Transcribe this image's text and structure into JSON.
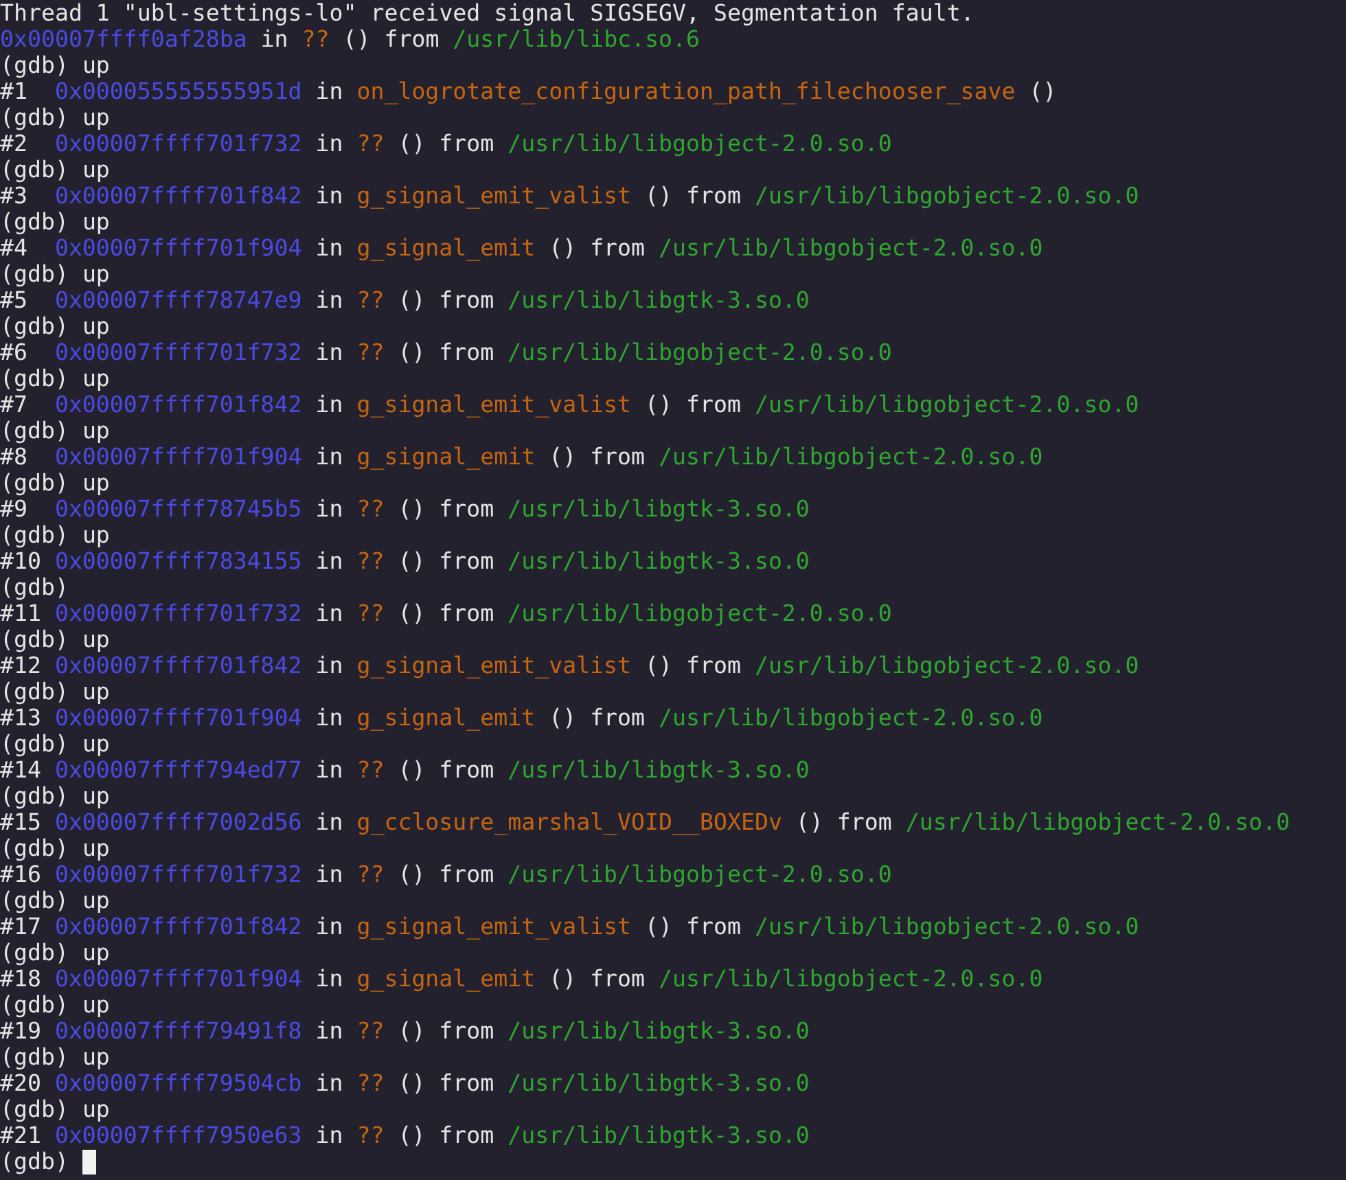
{
  "terminal": {
    "lines": [
      {
        "parts": [
          {
            "kind": "plain",
            "text": "Thread 1 \"ubl-settings-lo\" received signal SIGSEGV, Segmentation fault."
          }
        ]
      },
      {
        "parts": [
          {
            "kind": "address",
            "text": "0x00007ffff0af28ba"
          },
          {
            "kind": "plain",
            "text": "in"
          },
          {
            "kind": "function",
            "text": "??"
          },
          {
            "kind": "plain",
            "text": "() from"
          },
          {
            "kind": "path",
            "text": "/usr/lib/libc.so.6"
          }
        ]
      },
      {
        "parts": [
          {
            "kind": "plain",
            "text": "(gdb) up"
          }
        ]
      },
      {
        "parts": [
          {
            "kind": "number",
            "text": "#1"
          },
          {
            "kind": "address",
            "text": "0x000055555555951d"
          },
          {
            "kind": "plain",
            "text": "in"
          },
          {
            "kind": "function",
            "text": "on_logrotate_configuration_path_filechooser_save"
          },
          {
            "kind": "plain",
            "text": "()"
          }
        ]
      },
      {
        "parts": [
          {
            "kind": "plain",
            "text": "(gdb) up"
          }
        ]
      },
      {
        "parts": [
          {
            "kind": "number",
            "text": "#2"
          },
          {
            "kind": "address",
            "text": "0x00007ffff701f732"
          },
          {
            "kind": "plain",
            "text": "in"
          },
          {
            "kind": "function",
            "text": "??"
          },
          {
            "kind": "plain",
            "text": "() from"
          },
          {
            "kind": "path",
            "text": "/usr/lib/libgobject-2.0.so.0"
          }
        ]
      },
      {
        "parts": [
          {
            "kind": "plain",
            "text": "(gdb) up"
          }
        ]
      },
      {
        "parts": [
          {
            "kind": "number",
            "text": "#3"
          },
          {
            "kind": "address",
            "text": "0x00007ffff701f842"
          },
          {
            "kind": "plain",
            "text": "in"
          },
          {
            "kind": "function",
            "text": "g_signal_emit_valist"
          },
          {
            "kind": "plain",
            "text": "() from"
          },
          {
            "kind": "path",
            "text": "/usr/lib/libgobject-2.0.so.0"
          }
        ]
      },
      {
        "parts": [
          {
            "kind": "plain",
            "text": "(gdb) up"
          }
        ]
      },
      {
        "parts": [
          {
            "kind": "number",
            "text": "#4"
          },
          {
            "kind": "address",
            "text": "0x00007ffff701f904"
          },
          {
            "kind": "plain",
            "text": "in"
          },
          {
            "kind": "function",
            "text": "g_signal_emit"
          },
          {
            "kind": "plain",
            "text": "() from"
          },
          {
            "kind": "path",
            "text": "/usr/lib/libgobject-2.0.so.0"
          }
        ]
      },
      {
        "parts": [
          {
            "kind": "plain",
            "text": "(gdb) up"
          }
        ]
      },
      {
        "parts": [
          {
            "kind": "number",
            "text": "#5"
          },
          {
            "kind": "address",
            "text": "0x00007ffff78747e9"
          },
          {
            "kind": "plain",
            "text": "in"
          },
          {
            "kind": "function",
            "text": "??"
          },
          {
            "kind": "plain",
            "text": "() from"
          },
          {
            "kind": "path",
            "text": "/usr/lib/libgtk-3.so.0"
          }
        ]
      },
      {
        "parts": [
          {
            "kind": "plain",
            "text": "(gdb) up"
          }
        ]
      },
      {
        "parts": [
          {
            "kind": "number",
            "text": "#6"
          },
          {
            "kind": "address",
            "text": "0x00007ffff701f732"
          },
          {
            "kind": "plain",
            "text": "in"
          },
          {
            "kind": "function",
            "text": "??"
          },
          {
            "kind": "plain",
            "text": "() from"
          },
          {
            "kind": "path",
            "text": "/usr/lib/libgobject-2.0.so.0"
          }
        ]
      },
      {
        "parts": [
          {
            "kind": "plain",
            "text": "(gdb) up"
          }
        ]
      },
      {
        "parts": [
          {
            "kind": "number",
            "text": "#7"
          },
          {
            "kind": "address",
            "text": "0x00007ffff701f842"
          },
          {
            "kind": "plain",
            "text": "in"
          },
          {
            "kind": "function",
            "text": "g_signal_emit_valist"
          },
          {
            "kind": "plain",
            "text": "() from"
          },
          {
            "kind": "path",
            "text": "/usr/lib/libgobject-2.0.so.0"
          }
        ]
      },
      {
        "parts": [
          {
            "kind": "plain",
            "text": "(gdb) up"
          }
        ]
      },
      {
        "parts": [
          {
            "kind": "number",
            "text": "#8"
          },
          {
            "kind": "address",
            "text": "0x00007ffff701f904"
          },
          {
            "kind": "plain",
            "text": "in"
          },
          {
            "kind": "function",
            "text": "g_signal_emit"
          },
          {
            "kind": "plain",
            "text": "() from"
          },
          {
            "kind": "path",
            "text": "/usr/lib/libgobject-2.0.so.0"
          }
        ]
      },
      {
        "parts": [
          {
            "kind": "plain",
            "text": "(gdb) up"
          }
        ]
      },
      {
        "parts": [
          {
            "kind": "number",
            "text": "#9"
          },
          {
            "kind": "address",
            "text": "0x00007ffff78745b5"
          },
          {
            "kind": "plain",
            "text": "in"
          },
          {
            "kind": "function",
            "text": "??"
          },
          {
            "kind": "plain",
            "text": "() from"
          },
          {
            "kind": "path",
            "text": "/usr/lib/libgtk-3.so.0"
          }
        ]
      },
      {
        "parts": [
          {
            "kind": "plain",
            "text": "(gdb) up"
          }
        ]
      },
      {
        "parts": [
          {
            "kind": "number",
            "text": "#10"
          },
          {
            "kind": "address",
            "text": "0x00007ffff7834155"
          },
          {
            "kind": "plain",
            "text": "in"
          },
          {
            "kind": "function",
            "text": "??"
          },
          {
            "kind": "plain",
            "text": "() from"
          },
          {
            "kind": "path",
            "text": "/usr/lib/libgtk-3.so.0"
          }
        ]
      },
      {
        "parts": [
          {
            "kind": "plain",
            "text": "(gdb)"
          }
        ]
      },
      {
        "parts": [
          {
            "kind": "number",
            "text": "#11"
          },
          {
            "kind": "address",
            "text": "0x00007ffff701f732"
          },
          {
            "kind": "plain",
            "text": "in"
          },
          {
            "kind": "function",
            "text": "??"
          },
          {
            "kind": "plain",
            "text": "() from"
          },
          {
            "kind": "path",
            "text": "/usr/lib/libgobject-2.0.so.0"
          }
        ]
      },
      {
        "parts": [
          {
            "kind": "plain",
            "text": "(gdb) up"
          }
        ]
      },
      {
        "parts": [
          {
            "kind": "number",
            "text": "#12"
          },
          {
            "kind": "address",
            "text": "0x00007ffff701f842"
          },
          {
            "kind": "plain",
            "text": "in"
          },
          {
            "kind": "function",
            "text": "g_signal_emit_valist"
          },
          {
            "kind": "plain",
            "text": "() from"
          },
          {
            "kind": "path",
            "text": "/usr/lib/libgobject-2.0.so.0"
          }
        ]
      },
      {
        "parts": [
          {
            "kind": "plain",
            "text": "(gdb) up"
          }
        ]
      },
      {
        "parts": [
          {
            "kind": "number",
            "text": "#13"
          },
          {
            "kind": "address",
            "text": "0x00007ffff701f904"
          },
          {
            "kind": "plain",
            "text": "in"
          },
          {
            "kind": "function",
            "text": "g_signal_emit"
          },
          {
            "kind": "plain",
            "text": "() from"
          },
          {
            "kind": "path",
            "text": "/usr/lib/libgobject-2.0.so.0"
          }
        ]
      },
      {
        "parts": [
          {
            "kind": "plain",
            "text": "(gdb) up"
          }
        ]
      },
      {
        "parts": [
          {
            "kind": "number",
            "text": "#14"
          },
          {
            "kind": "address",
            "text": "0x00007ffff794ed77"
          },
          {
            "kind": "plain",
            "text": "in"
          },
          {
            "kind": "function",
            "text": "??"
          },
          {
            "kind": "plain",
            "text": "() from"
          },
          {
            "kind": "path",
            "text": "/usr/lib/libgtk-3.so.0"
          }
        ]
      },
      {
        "parts": [
          {
            "kind": "plain",
            "text": "(gdb) up"
          }
        ]
      },
      {
        "parts": [
          {
            "kind": "number",
            "text": "#15"
          },
          {
            "kind": "address",
            "text": "0x00007ffff7002d56"
          },
          {
            "kind": "plain",
            "text": "in"
          },
          {
            "kind": "function",
            "text": "g_cclosure_marshal_VOID__BOXEDv"
          },
          {
            "kind": "plain",
            "text": "() from"
          },
          {
            "kind": "path",
            "text": "/usr/lib/libgobject-2.0.so.0"
          }
        ]
      },
      {
        "parts": [
          {
            "kind": "plain",
            "text": "(gdb) up"
          }
        ]
      },
      {
        "parts": [
          {
            "kind": "number",
            "text": "#16"
          },
          {
            "kind": "address",
            "text": "0x00007ffff701f732"
          },
          {
            "kind": "plain",
            "text": "in"
          },
          {
            "kind": "function",
            "text": "??"
          },
          {
            "kind": "plain",
            "text": "() from"
          },
          {
            "kind": "path",
            "text": "/usr/lib/libgobject-2.0.so.0"
          }
        ]
      },
      {
        "parts": [
          {
            "kind": "plain",
            "text": "(gdb) up"
          }
        ]
      },
      {
        "parts": [
          {
            "kind": "number",
            "text": "#17"
          },
          {
            "kind": "address",
            "text": "0x00007ffff701f842"
          },
          {
            "kind": "plain",
            "text": "in"
          },
          {
            "kind": "function",
            "text": "g_signal_emit_valist"
          },
          {
            "kind": "plain",
            "text": "() from"
          },
          {
            "kind": "path",
            "text": "/usr/lib/libgobject-2.0.so.0"
          }
        ]
      },
      {
        "parts": [
          {
            "kind": "plain",
            "text": "(gdb) up"
          }
        ]
      },
      {
        "parts": [
          {
            "kind": "number",
            "text": "#18"
          },
          {
            "kind": "address",
            "text": "0x00007ffff701f904"
          },
          {
            "kind": "plain",
            "text": "in"
          },
          {
            "kind": "function",
            "text": "g_signal_emit"
          },
          {
            "kind": "plain",
            "text": "() from"
          },
          {
            "kind": "path",
            "text": "/usr/lib/libgobject-2.0.so.0"
          }
        ]
      },
      {
        "parts": [
          {
            "kind": "plain",
            "text": "(gdb) up"
          }
        ]
      },
      {
        "parts": [
          {
            "kind": "number",
            "text": "#19"
          },
          {
            "kind": "address",
            "text": "0x00007ffff79491f8"
          },
          {
            "kind": "plain",
            "text": "in"
          },
          {
            "kind": "function",
            "text": "??"
          },
          {
            "kind": "plain",
            "text": "() from"
          },
          {
            "kind": "path",
            "text": "/usr/lib/libgtk-3.so.0"
          }
        ]
      },
      {
        "parts": [
          {
            "kind": "plain",
            "text": "(gdb) up"
          }
        ]
      },
      {
        "parts": [
          {
            "kind": "number",
            "text": "#20"
          },
          {
            "kind": "address",
            "text": "0x00007ffff79504cb"
          },
          {
            "kind": "plain",
            "text": "in"
          },
          {
            "kind": "function",
            "text": "??"
          },
          {
            "kind": "plain",
            "text": "() from"
          },
          {
            "kind": "path",
            "text": "/usr/lib/libgtk-3.so.0"
          }
        ]
      },
      {
        "parts": [
          {
            "kind": "plain",
            "text": "(gdb) up"
          }
        ]
      },
      {
        "parts": [
          {
            "kind": "number",
            "text": "#21"
          },
          {
            "kind": "address",
            "text": "0x00007ffff7950e63"
          },
          {
            "kind": "plain",
            "text": "in"
          },
          {
            "kind": "function",
            "text": "??"
          },
          {
            "kind": "plain",
            "text": "() from"
          },
          {
            "kind": "path",
            "text": "/usr/lib/libgtk-3.so.0"
          }
        ]
      },
      {
        "parts": [
          {
            "kind": "plain",
            "text": "(gdb)"
          }
        ],
        "cursor": true
      }
    ]
  }
}
